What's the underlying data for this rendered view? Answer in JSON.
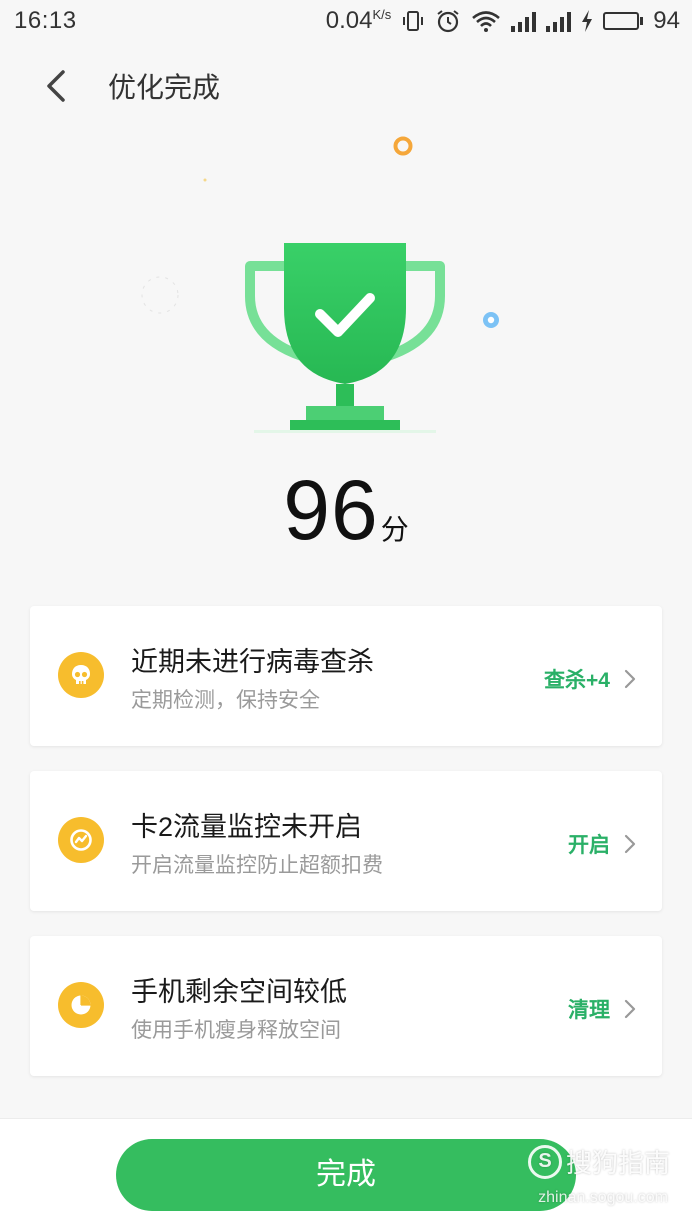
{
  "status_bar": {
    "time": "16:13",
    "net_speed": "0.04",
    "net_speed_unit": "K/s",
    "battery_level": "94",
    "battery_fraction": 0.94
  },
  "header": {
    "title": "优化完成"
  },
  "result": {
    "score": "96",
    "unit": "分"
  },
  "cards": [
    {
      "title": "近期未进行病毒查杀",
      "subtitle": "定期检测，保持安全",
      "action": "查杀+4",
      "icon": "skull-icon"
    },
    {
      "title": "卡2流量监控未开启",
      "subtitle": "开启流量监控防止超额扣费",
      "action": "开启",
      "icon": "traffic-monitor-icon"
    },
    {
      "title": "手机剩余空间较低",
      "subtitle": "使用手机瘦身释放空间",
      "action": "清理",
      "icon": "pie-chart-icon"
    }
  ],
  "footer": {
    "done_label": "完成"
  },
  "watermark": {
    "text": "搜狗指南",
    "url": "zhinan.sogou.com"
  },
  "colors": {
    "accent_green": "#2ab067",
    "button_green": "#35bd5f",
    "icon_yellow": "#f7bd2d"
  }
}
